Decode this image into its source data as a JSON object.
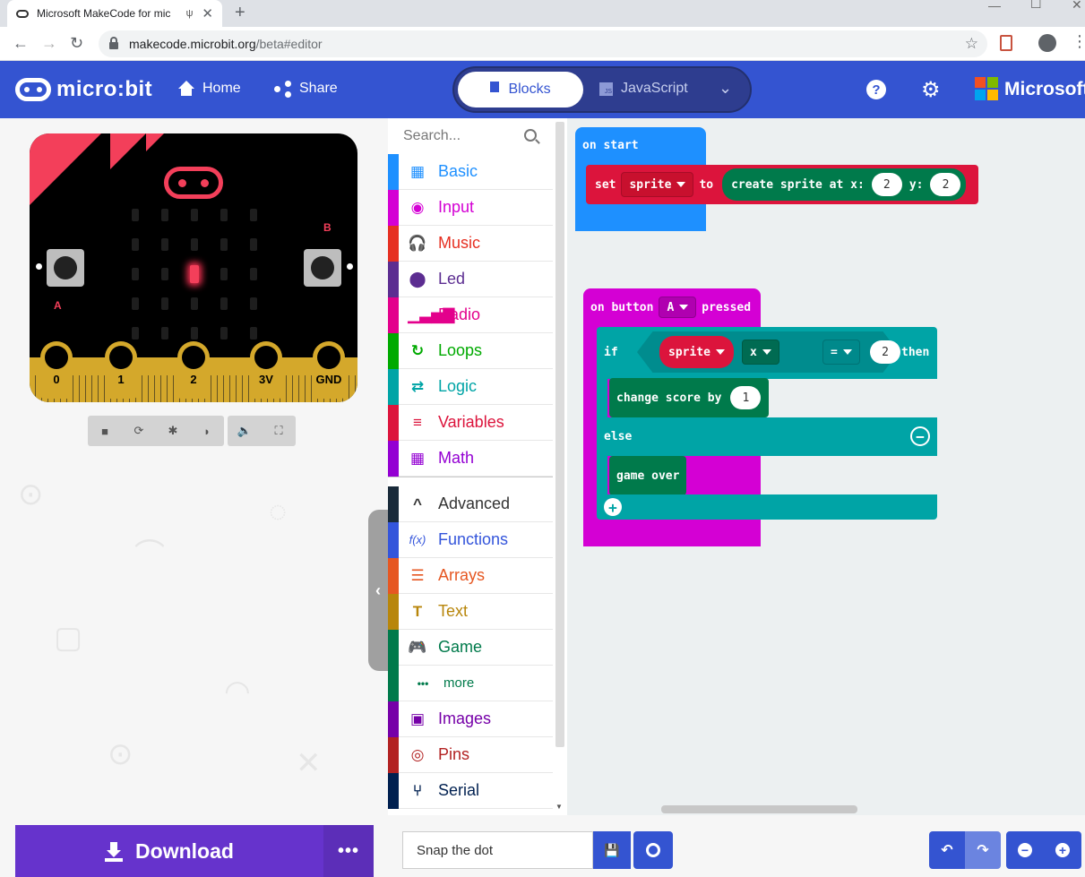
{
  "browser": {
    "tab_title": "Microsoft MakeCode for mic",
    "url_host": "makecode.microbit.org",
    "url_path": "/beta#editor"
  },
  "header": {
    "logo_text": "micro:bit",
    "home_label": "Home",
    "share_label": "Share",
    "blocks_label": "Blocks",
    "javascript_label": "JavaScript",
    "help_icon": "?",
    "brand_label": "Microsoft"
  },
  "simulator": {
    "button_a": "A",
    "button_b": "B",
    "pins": [
      "0",
      "1",
      "2",
      "3V",
      "GND"
    ],
    "lit_led": {
      "row": 2,
      "col": 2
    },
    "tools": [
      "stop-icon",
      "restart-icon",
      "debug-icon",
      "slowmo-icon",
      "mute-icon",
      "fullscreen-icon"
    ]
  },
  "toolbox": {
    "search_placeholder": "Search...",
    "categories": [
      {
        "label": "Basic",
        "color": "#1e90ff",
        "icon": "▦"
      },
      {
        "label": "Input",
        "color": "#d400d4",
        "icon": "◉"
      },
      {
        "label": "Music",
        "color": "#e63022",
        "icon": "🎧"
      },
      {
        "label": "Led",
        "color": "#5c2d91",
        "icon": "⬤"
      },
      {
        "label": "Radio",
        "color": "#e3008c",
        "icon": "▁▃▅▇"
      },
      {
        "label": "Loops",
        "color": "#00aa00",
        "icon": "↻"
      },
      {
        "label": "Logic",
        "color": "#00a4a6",
        "icon": "⇄"
      },
      {
        "label": "Variables",
        "color": "#dc143c",
        "icon": "≡"
      },
      {
        "label": "Math",
        "color": "#9400d3",
        "icon": "▦"
      }
    ],
    "advanced": [
      {
        "label": "Advanced",
        "color": "#333333",
        "stripe": "#1a2b3a",
        "icon": "^"
      },
      {
        "label": "Functions",
        "color": "#3455db",
        "icon": "f(x)"
      },
      {
        "label": "Arrays",
        "color": "#e65722",
        "icon": "☰"
      },
      {
        "label": "Text",
        "color": "#b8860b",
        "icon": "T"
      },
      {
        "label": "Game",
        "color": "#007a4b",
        "icon": "🎮"
      },
      {
        "label": "more",
        "color": "#007a4b",
        "icon": "•••"
      },
      {
        "label": "Images",
        "color": "#7600a8",
        "icon": "▣"
      },
      {
        "label": "Pins",
        "color": "#b22222",
        "icon": "◎"
      },
      {
        "label": "Serial",
        "color": "#002050",
        "icon": "⑂"
      }
    ]
  },
  "workspace": {
    "on_start": "on start",
    "set": "set",
    "sprite_var": "sprite",
    "to": "to",
    "create_sprite": "create sprite at x:",
    "x_val": "2",
    "y_label": "y:",
    "y_val": "2",
    "on_button": "on button",
    "button_opt": "A",
    "pressed": "pressed",
    "if": "if",
    "sprite_var2": "sprite",
    "prop": "x",
    "op": "=",
    "cmp_val": "2",
    "then": "then",
    "change_score": "change score by",
    "score_val": "1",
    "else": "else",
    "game_over": "game over"
  },
  "footer": {
    "download_label": "Download",
    "more_label": "•••",
    "project_name": "Snap the dot"
  }
}
